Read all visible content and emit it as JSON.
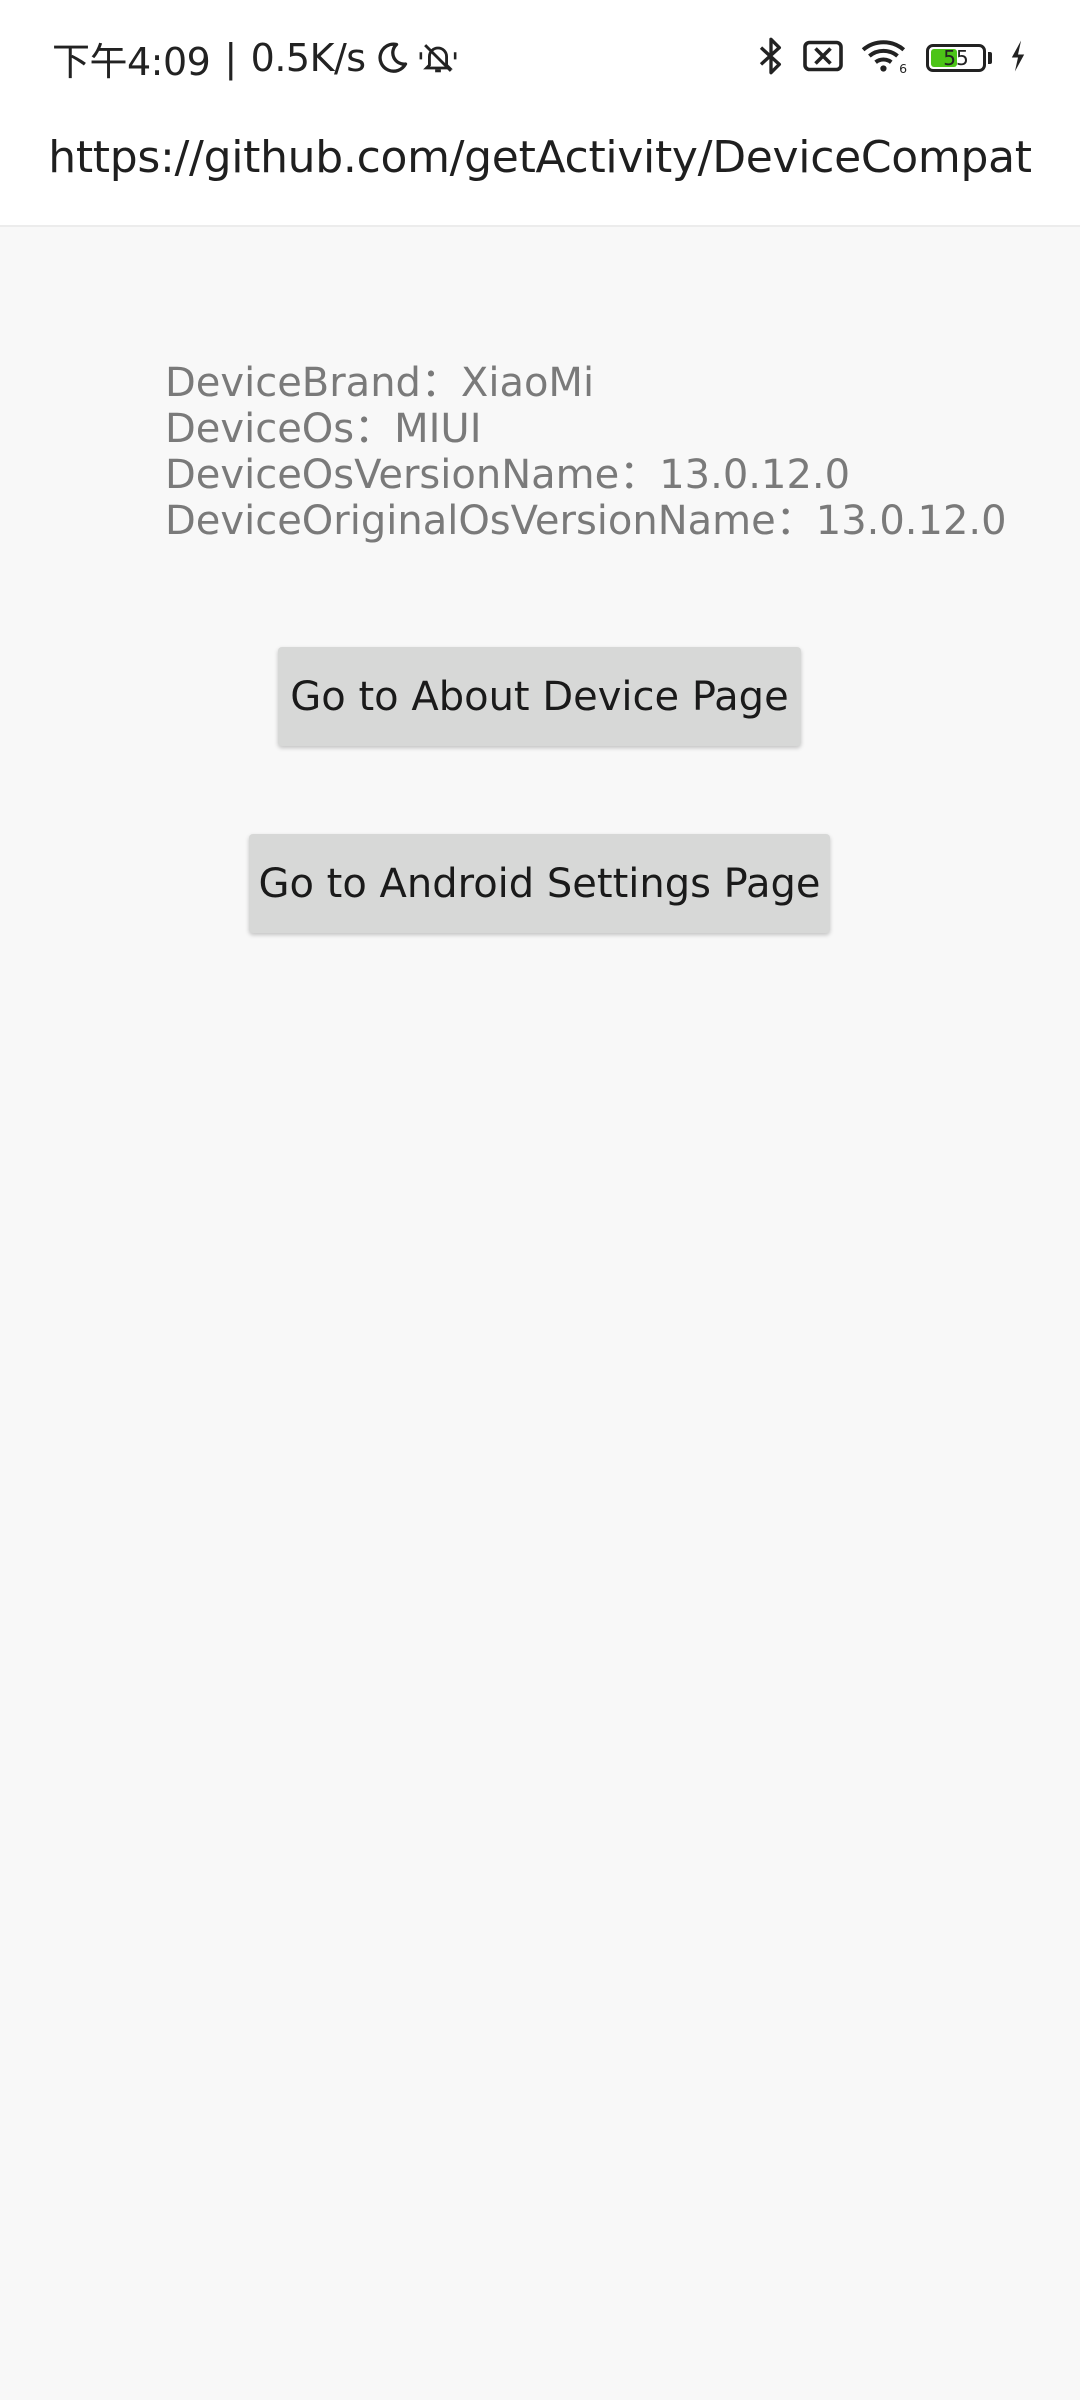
{
  "status_bar": {
    "time": "下午4:09",
    "separator": "|",
    "network_speed": "0.5K/s",
    "icons_left": [
      "moon-icon",
      "bell-muted-icon"
    ],
    "icons_right": [
      "bluetooth-icon",
      "no-sim-icon",
      "wifi-icon",
      "battery-icon",
      "charging-icon"
    ],
    "battery_level": "55",
    "battery_color": "#4cc417"
  },
  "toolbar": {
    "title": "https://github.com/getActivity/DeviceCompat"
  },
  "device_info": {
    "brand": "DeviceBrand：XiaoMi",
    "os": "DeviceOs：MIUI",
    "os_version_name": "DeviceOsVersionName：13.0.12.0",
    "original_os_version_name": "DeviceOriginalOsVersionName：13.0.12.0"
  },
  "buttons": {
    "about_device": "Go to About Device Page",
    "android_settings": "Go to Android Settings Page"
  }
}
